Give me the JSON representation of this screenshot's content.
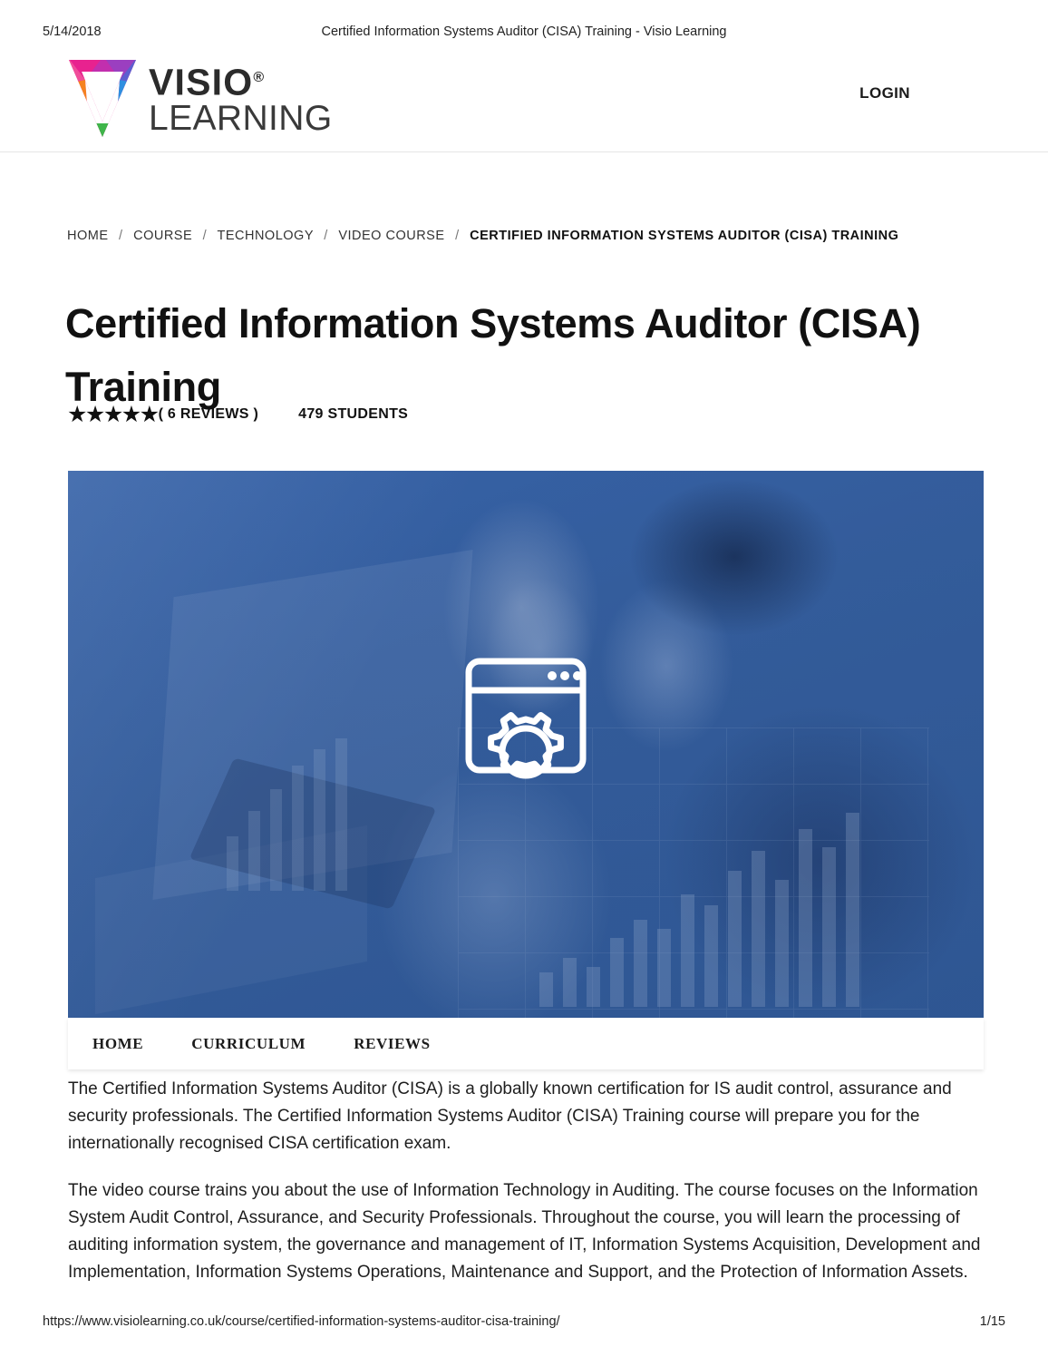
{
  "print": {
    "date": "5/14/2018",
    "doc_title": "Certified Information Systems Auditor (CISA) Training - Visio Learning",
    "url": "https://www.visiolearning.co.uk/course/certified-information-systems-auditor-cisa-training/",
    "page_number": "1/15"
  },
  "header": {
    "brand_primary": "VISIO",
    "brand_trademark": "®",
    "brand_secondary": "LEARNING",
    "login_label": "LOGIN"
  },
  "breadcrumb": {
    "items": [
      {
        "label": "HOME",
        "current": false
      },
      {
        "label": "COURSE",
        "current": false
      },
      {
        "label": "TECHNOLOGY",
        "current": false
      },
      {
        "label": "VIDEO COURSE",
        "current": false
      },
      {
        "label": "CERTIFIED INFORMATION SYSTEMS AUDITOR (CISA) TRAINING",
        "current": true
      }
    ],
    "separator": "/"
  },
  "course": {
    "title": "Certified Information Systems Auditor (CISA) Training",
    "rating_stars": "★★★★★",
    "rating_value": 5,
    "reviews_label": "( 6 REVIEWS )",
    "reviews_count": 6,
    "students_label": "479 STUDENTS",
    "students_count": 479
  },
  "hero": {
    "icon_name": "browser-gear-icon",
    "overlay_color": "#2e5491",
    "base_color": "#3b6ab4"
  },
  "tabs": [
    {
      "label": "HOME",
      "active": true
    },
    {
      "label": "CURRICULUM",
      "active": false
    },
    {
      "label": "REVIEWS",
      "active": false
    }
  ],
  "content": {
    "paragraphs": [
      "The Certified Information Systems Auditor (CISA) is a globally known certification for IS audit control, assurance and security professionals. The Certified Information Systems Auditor (CISA) Training course will prepare you for the internationally recognised CISA certification exam.",
      "The video course trains you about the use of Information Technology in Auditing. The course focuses on the Information System Audit Control, Assurance, and Security Professionals. Throughout the course, you will learn the processing of auditing information system, the governance and management of IT, Information Systems Acquisition, Development and Implementation, Information Systems Operations, Maintenance and Support, and the Protection of Information Assets."
    ]
  }
}
